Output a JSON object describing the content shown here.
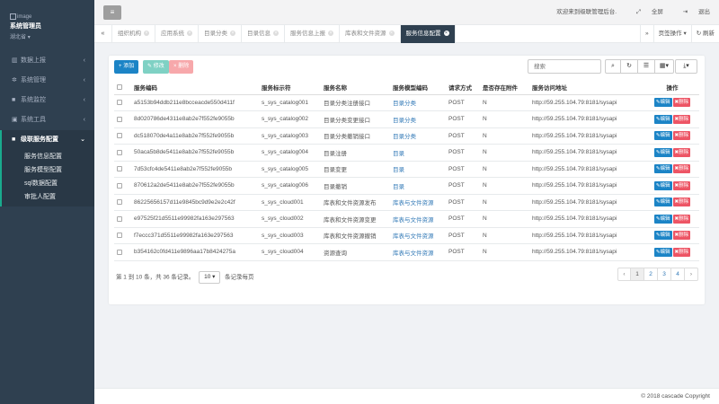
{
  "sidebar": {
    "profile_image_alt": "image",
    "user_name": "系统管理员",
    "user_region": "湖北省",
    "items": [
      {
        "label": "数据上报",
        "icon": "chart-icon"
      },
      {
        "label": "系统管理",
        "icon": "gear-icon"
      },
      {
        "label": "系统监控",
        "icon": "video-icon"
      },
      {
        "label": "系统工具",
        "icon": "briefcase-icon"
      }
    ],
    "active_item": {
      "label": "级联服务配置",
      "icon": "lock-icon"
    },
    "sub_items": [
      "服务信息配置",
      "服务模型配置",
      "sql数据配置",
      "审批人配置"
    ]
  },
  "topbar": {
    "welcome": "欢迎来到级联管理后台.",
    "fullscreen": "全屏",
    "logout": "退出"
  },
  "tabs": {
    "items": [
      "组织机构",
      "应用系统",
      "目录分类",
      "目录信息",
      "服务信息上报",
      "库表和文件资源",
      "服务信息配置"
    ],
    "active_index": 6,
    "page_ops": "页签操作",
    "refresh": "刷新"
  },
  "toolbar": {
    "add": "添加",
    "edit": "修改",
    "delete": "删除",
    "search_placeholder": "搜索"
  },
  "table": {
    "headers": [
      "服务编码",
      "服务标示符",
      "服务名称",
      "服务模型编码",
      "请求方式",
      "是否存在附件",
      "服务访问地址",
      "操作"
    ],
    "edit_label": "编辑",
    "delete_label": "删除",
    "rows": [
      {
        "code": "a5153b94ddb211e8bcceacde550d411f",
        "ident": "s_sys_catalog001",
        "name": "目录分类注册接口",
        "model": "目录分类",
        "method": "POST",
        "attach": "N",
        "url": "http://59.255.104.79:8181/sysapi"
      },
      {
        "code": "8d020786de4311e8ab2e7f552fe9055b",
        "ident": "s_sys_catalog002",
        "name": "目录分类变更接口",
        "model": "目录分类",
        "method": "POST",
        "attach": "N",
        "url": "http://59.255.104.79:8181/sysapi"
      },
      {
        "code": "dc518070de4a11e8ab2e7f552fe9055b",
        "ident": "s_sys_catalog003",
        "name": "目录分类撤销接口",
        "model": "目录分类",
        "method": "POST",
        "attach": "N",
        "url": "http://59.255.104.79:8181/sysapi"
      },
      {
        "code": "50aca5b8de5411e8ab2e7f552fe9055b",
        "ident": "s_sys_catalog004",
        "name": "目录注册",
        "model": "目录",
        "method": "POST",
        "attach": "N",
        "url": "http://59.255.104.79:8181/sysapi"
      },
      {
        "code": "7d53cfc4de5411e8ab2e7f552fe9055b",
        "ident": "s_sys_catalog005",
        "name": "目录变更",
        "model": "目录",
        "method": "POST",
        "attach": "N",
        "url": "http://59.255.104.79:8181/sysapi"
      },
      {
        "code": "870612a2de5411e8ab2e7f552fe9055b",
        "ident": "s_sys_catalog006",
        "name": "目录撤销",
        "model": "目录",
        "method": "POST",
        "attach": "N",
        "url": "http://59.255.104.79:8181/sysapi"
      },
      {
        "code": "86225656157d11e9845bc9d9e2e2c42f",
        "ident": "s_sys_cloud001",
        "name": "库表和文件资源发布",
        "model": "库表与文件资源",
        "method": "POST",
        "attach": "N",
        "url": "http://59.255.104.79:8181/sysapi"
      },
      {
        "code": "e97525f21d5511e99982fa163e297563",
        "ident": "s_sys_cloud002",
        "name": "库表和文件资源变更",
        "model": "库表与文件资源",
        "method": "POST",
        "attach": "N",
        "url": "http://59.255.104.79:8181/sysapi"
      },
      {
        "code": "f7eccc371d5511e99982fa163e297563",
        "ident": "s_sys_cloud003",
        "name": "库表和文件资源撤销",
        "model": "库表与文件资源",
        "method": "POST",
        "attach": "N",
        "url": "http://59.255.104.79:8181/sysapi"
      },
      {
        "code": "b354162c0fd411e9896aa17b8424275a",
        "ident": "s_sys_cloud004",
        "name": "资源查询",
        "model": "库表与文件资源",
        "method": "POST",
        "attach": "N",
        "url": "http://59.255.104.79:8181/sysapi"
      }
    ]
  },
  "pagination": {
    "info_prefix": "第 1 到 10 条，共 36 条记录。",
    "page_size": "10",
    "info_suffix": "条记录每页",
    "prev": "‹",
    "pages": [
      "1",
      "2",
      "3",
      "4"
    ],
    "next": "›",
    "current": "1"
  },
  "footer": {
    "copyright": "© 2018 cascade Copyright"
  }
}
